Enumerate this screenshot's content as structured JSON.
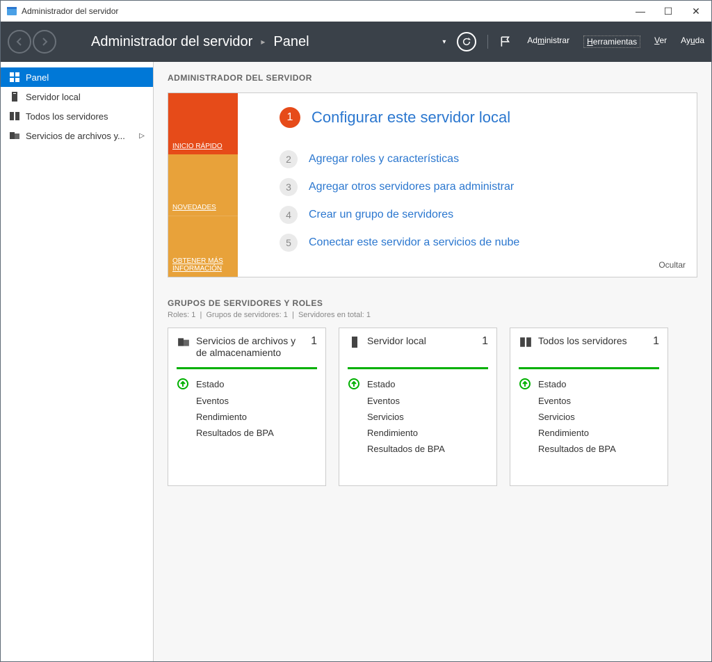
{
  "window": {
    "title": "Administrador del servidor"
  },
  "banner": {
    "breadcrumb": {
      "app": "Administrador del servidor",
      "page": "Panel"
    },
    "menu": {
      "manage": "Administrar",
      "tools": "Herramientas",
      "view": "Ver",
      "help": "Ayuda"
    }
  },
  "sidebar": {
    "items": [
      {
        "label": "Panel",
        "icon": "dashboard"
      },
      {
        "label": "Servidor local",
        "icon": "server-single"
      },
      {
        "label": "Todos los servidores",
        "icon": "server-multi"
      },
      {
        "label": "Servicios de archivos y...",
        "icon": "files",
        "chevron": true
      }
    ]
  },
  "welcome": {
    "heading": "ADMINISTRADOR DEL SERVIDOR",
    "tiles": {
      "quickstart": "INICIO RÁPIDO",
      "whatsnew": "NOVEDADES",
      "learn": "OBTENER MÁS INFORMACIÓN"
    },
    "steps": [
      {
        "n": "1",
        "label": "Configurar este servidor local",
        "primary": true
      },
      {
        "n": "2",
        "label": "Agregar roles y características"
      },
      {
        "n": "3",
        "label": "Agregar otros servidores para administrar"
      },
      {
        "n": "4",
        "label": "Crear un grupo de servidores"
      },
      {
        "n": "5",
        "label": "Conectar este servidor a servicios de nube"
      }
    ],
    "hide": "Ocultar"
  },
  "groups": {
    "heading": "GRUPOS DE SERVIDORES Y ROLES",
    "sub_roles_label": "Roles:",
    "sub_roles_value": "1",
    "sub_groups_label": "Grupos de servidores:",
    "sub_groups_value": "1",
    "sub_total_label": "Servidores en total:",
    "sub_total_value": "1",
    "tiles": [
      {
        "title": "Servicios de archivos y de almacenamiento",
        "count": "1",
        "icon": "files",
        "rows": [
          "Estado",
          "Eventos",
          "Rendimiento",
          "Resultados de BPA"
        ]
      },
      {
        "title": "Servidor local",
        "count": "1",
        "icon": "server-single",
        "rows": [
          "Estado",
          "Eventos",
          "Servicios",
          "Rendimiento",
          "Resultados de BPA"
        ]
      },
      {
        "title": "Todos los servidores",
        "count": "1",
        "icon": "server-multi",
        "rows": [
          "Estado",
          "Eventos",
          "Servicios",
          "Rendimiento",
          "Resultados de BPA"
        ]
      }
    ]
  }
}
